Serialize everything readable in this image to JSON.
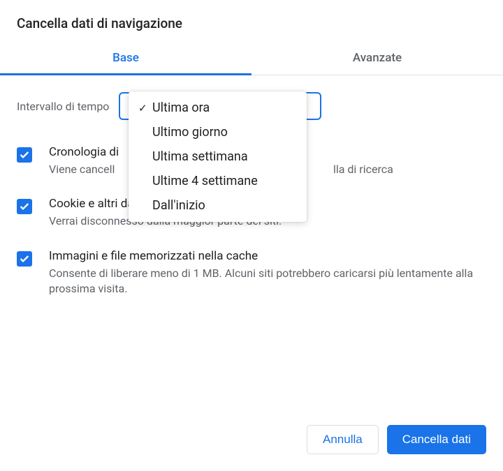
{
  "dialog": {
    "title": "Cancella dati di navigazione"
  },
  "tabs": {
    "base": "Base",
    "advanced": "Avanzate"
  },
  "timeRange": {
    "label": "Intervallo di tempo",
    "options": [
      "Ultima ora",
      "Ultimo giorno",
      "Ultima settimana",
      "Ultime 4 settimane",
      "Dall'inizio"
    ],
    "selectedIndex": 0
  },
  "options": {
    "history": {
      "title": "Cronologia di",
      "desc_pre": "Viene cancell",
      "desc_post": "lla di ricerca"
    },
    "cookies": {
      "title": "Cookie e altri dati dei siti",
      "desc": "Verrai disconnesso dalla maggior parte dei siti."
    },
    "cache": {
      "title": "Immagini e file memorizzati nella cache",
      "desc": "Consente di liberare meno di 1 MB. Alcuni siti potrebbero caricarsi più lentamente alla prossima visita."
    }
  },
  "buttons": {
    "cancel": "Annulla",
    "clear": "Cancella dati"
  },
  "colors": {
    "primary": "#1a73e8"
  }
}
